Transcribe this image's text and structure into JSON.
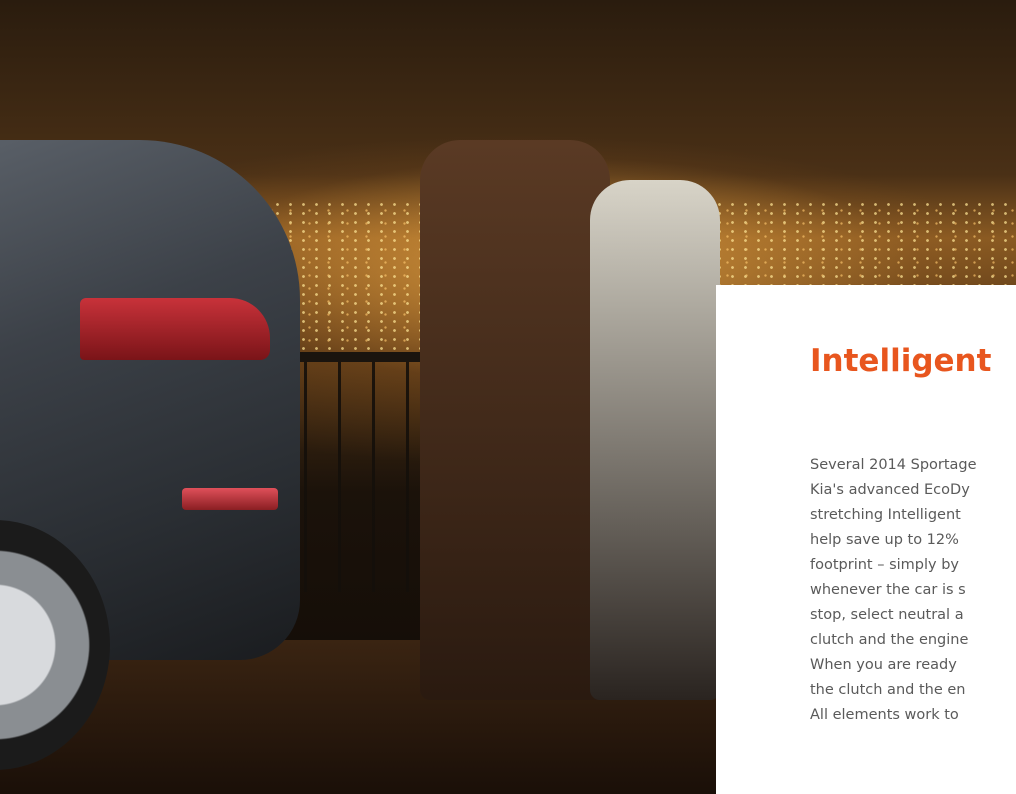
{
  "hero": {
    "image_alt": "Couple at a night overlook with a car"
  },
  "panel": {
    "heading": "Intelligent",
    "body_lines": [
      "Several 2014 Sportage",
      "Kia's advanced EcoDy",
      "stretching Intelligent",
      "help save up to 12%",
      "footprint – simply by",
      "whenever the car is s",
      "stop, select neutral a",
      "clutch and the engine",
      "When you are ready",
      "the clutch and the en",
      "All elements work to"
    ]
  },
  "colors": {
    "accent": "#e8561e",
    "body_text": "#5a5a5a"
  }
}
